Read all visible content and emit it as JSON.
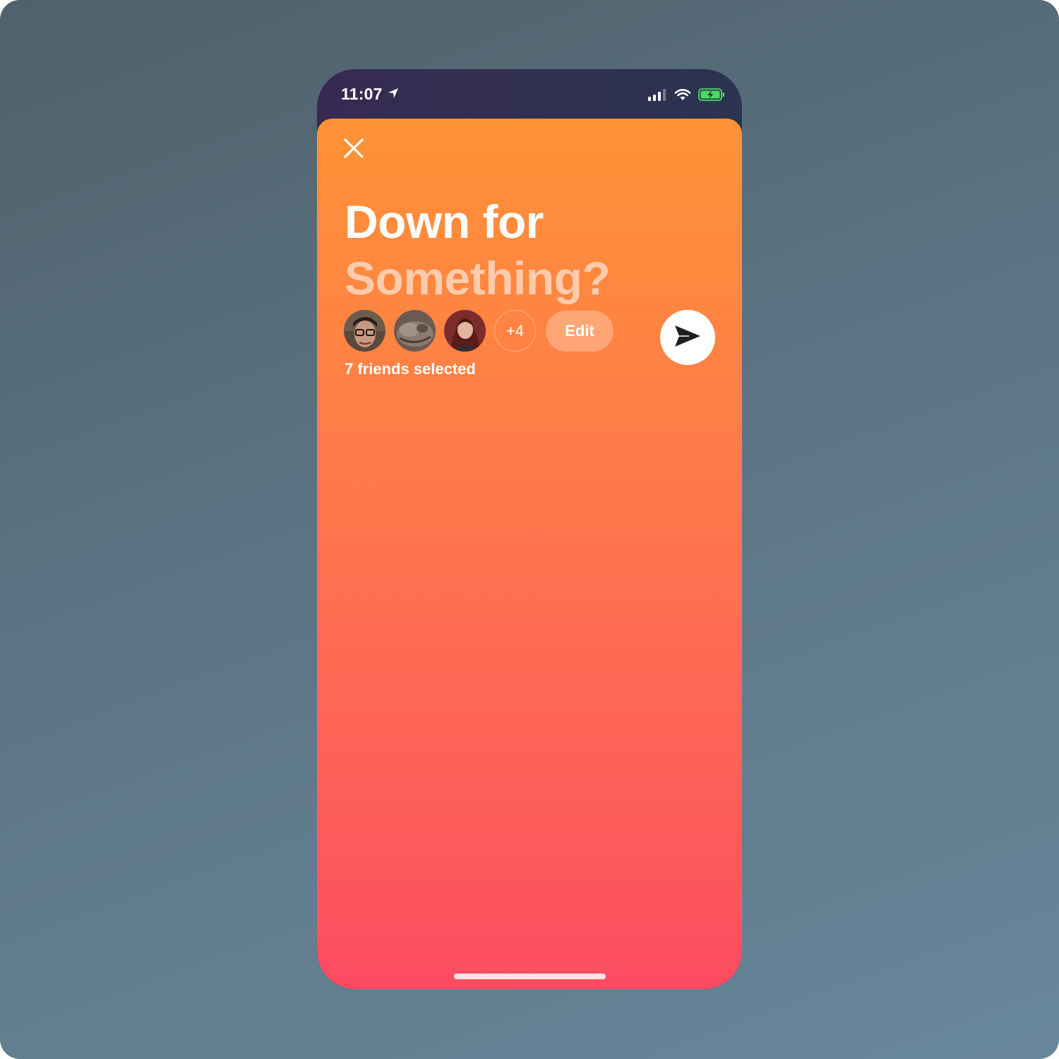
{
  "status_bar": {
    "time": "11:07",
    "location_icon": "location-arrow-icon",
    "signal_icon": "cellular-signal-icon",
    "wifi_icon": "wifi-icon",
    "battery_icon": "battery-charging-icon",
    "battery_color": "#4cd964"
  },
  "header": {
    "close_icon": "close-icon"
  },
  "title": {
    "line1": "Down for",
    "line2": "Something?"
  },
  "friends": {
    "avatars": [
      {
        "description": "man-with-glasses-avatar"
      },
      {
        "description": "cat-avatar"
      },
      {
        "description": "woman-avatar"
      }
    ],
    "more_count": "+4",
    "edit_label": "Edit",
    "selected_text": "7 friends selected"
  },
  "send": {
    "icon": "send-icon"
  },
  "colors": {
    "gradient_top": "#ff9336",
    "gradient_bottom": "#fc4b62",
    "title_secondary": "#ffd3b8"
  }
}
